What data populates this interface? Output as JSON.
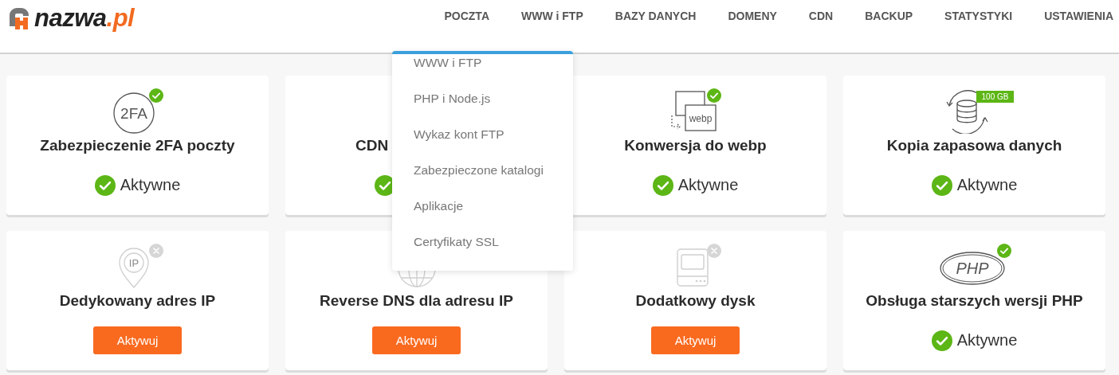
{
  "logo": {
    "name": "nazwa",
    "suffix": ".pl"
  },
  "nav": [
    {
      "label": "POCZTA"
    },
    {
      "label": "WWW i FTP",
      "menu": [
        "WWW i FTP",
        "PHP i Node.js",
        "Wykaz kont FTP",
        "Zabezpieczone katalogi",
        "Aplikacje",
        "Certyfikaty SSL"
      ]
    },
    {
      "label": "BAZY DANYCH"
    },
    {
      "label": "DOMENY"
    },
    {
      "label": "CDN"
    },
    {
      "label": "BACKUP"
    },
    {
      "label": "STATYSTYKI"
    },
    {
      "label": "USTAWIENIA"
    }
  ],
  "cards": [
    {
      "kind": "authentication",
      "icon_text": "2FA",
      "enabled": true,
      "title": "Zabezpieczenie 2FA poczty",
      "status": {
        "kind": "active",
        "label": "Aktywne"
      }
    },
    {
      "title": "CDN",
      "covered": true,
      "status": {
        "kind": "active"
      }
    },
    {
      "kind": "webp",
      "icon_text": "webp",
      "enabled": true,
      "title": "Konwersja do webp",
      "status": {
        "kind": "active",
        "label": "Aktywne"
      }
    },
    {
      "kind": "backup",
      "icon_text": "100 GB",
      "title": "Kopia zapasowa danych",
      "status": {
        "kind": "active",
        "label": "Aktywne"
      }
    },
    {
      "kind": "ip",
      "icon_text": "IP",
      "enabled": false,
      "title": "Dedykowany adres IP",
      "status": {
        "kind": "button",
        "label": "Aktywuj"
      }
    },
    {
      "kind": "globe",
      "title": "Reverse DNS dla adresu IP",
      "status": {
        "kind": "button",
        "label": "Aktywuj"
      }
    },
    {
      "kind": "disk",
      "enabled": false,
      "title": "Dodatkowy dysk",
      "status": {
        "kind": "button",
        "label": "Aktywuj"
      }
    },
    {
      "kind": "php",
      "icon_text": "PHP",
      "enabled": true,
      "title": "Obsługa starszych wersji PHP",
      "status": {
        "kind": "active",
        "label": "Aktywne"
      }
    }
  ]
}
